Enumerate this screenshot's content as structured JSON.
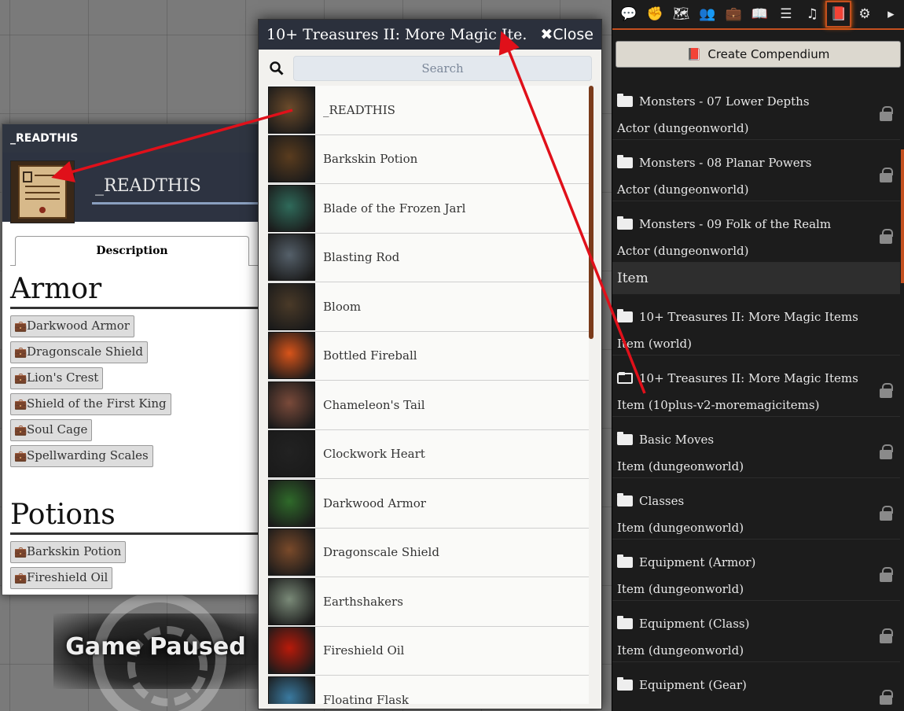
{
  "overlay": {
    "paused_text": "Game Paused"
  },
  "item_sheet": {
    "header_title": "_READTHIS",
    "name_value": "_READTHIS",
    "tab_label": "Description",
    "sections": [
      {
        "heading": "Armor",
        "items": [
          "Darkwood Armor",
          "Dragonscale Shield",
          "Lion's Crest",
          "Shield of the First King",
          "Soul Cage",
          "Spellwarding Scales"
        ]
      },
      {
        "heading": "Potions",
        "items": [
          "Barkskin Potion",
          "Fireshield Oil"
        ]
      }
    ]
  },
  "compendium": {
    "title": "10+ Treasures II: More Magic Ite...",
    "close_label": "Close",
    "search_placeholder": "Search",
    "entries": [
      {
        "name": "_READTHIS",
        "color": "#6b4a2a"
      },
      {
        "name": "Barkskin Potion",
        "color": "#5a3c1e"
      },
      {
        "name": "Blade of the Frozen Jarl",
        "color": "#2f6a5a"
      },
      {
        "name": "Blasting Rod",
        "color": "#55606a"
      },
      {
        "name": "Bloom",
        "color": "#4a3a28"
      },
      {
        "name": "Bottled Fireball",
        "color": "#d8541a"
      },
      {
        "name": "Chameleon's Tail",
        "color": "#7a4a3a"
      },
      {
        "name": "Clockwork Heart",
        "color": "#222222"
      },
      {
        "name": "Darkwood Armor",
        "color": "#2f6a2a"
      },
      {
        "name": "Dragonscale Shield",
        "color": "#7a4a2a"
      },
      {
        "name": "Earthshakers",
        "color": "#7a8a78"
      },
      {
        "name": "Fireshield Oil",
        "color": "#b81a0a"
      },
      {
        "name": "Floating Flask",
        "color": "#3a7aa0"
      }
    ]
  },
  "sidebar": {
    "tabs": [
      {
        "name": "chat-tab",
        "glyph": "💬"
      },
      {
        "name": "combat-tab",
        "glyph": "✊"
      },
      {
        "name": "scenes-tab",
        "glyph": "🗺"
      },
      {
        "name": "actors-tab",
        "glyph": "👥"
      },
      {
        "name": "items-tab",
        "glyph": "💼"
      },
      {
        "name": "journal-tab",
        "glyph": "📖"
      },
      {
        "name": "tables-tab",
        "glyph": "☰"
      },
      {
        "name": "playlists-tab",
        "glyph": "♫"
      },
      {
        "name": "compendium-tab",
        "glyph": "📕"
      },
      {
        "name": "settings-tab",
        "glyph": "⚙"
      },
      {
        "name": "collapse-tab",
        "glyph": "▸"
      }
    ],
    "create_button": "Create Compendium",
    "packs_top": [
      {
        "title": "Monsters - 07 Lower Depths",
        "sub": "Actor (dungeonworld)"
      },
      {
        "title": "Monsters - 08 Planar Powers",
        "sub": "Actor (dungeonworld)"
      },
      {
        "title": "Monsters - 09 Folk of the Realm",
        "sub": "Actor (dungeonworld)"
      }
    ],
    "group_label": "Item",
    "packs_item": [
      {
        "title": "10+ Treasures II: More Magic Items",
        "sub": "Item (world)",
        "locked": false,
        "open": false
      },
      {
        "title": "10+ Treasures II: More Magic Items",
        "sub": "Item (10plus-v2-moremagicitems)",
        "locked": true,
        "open": true
      },
      {
        "title": "Basic Moves",
        "sub": "Item (dungeonworld)",
        "locked": true,
        "open": false
      },
      {
        "title": "Classes",
        "sub": "Item (dungeonworld)",
        "locked": true,
        "open": false
      },
      {
        "title": "Equipment (Armor)",
        "sub": "Item (dungeonworld)",
        "locked": true,
        "open": false
      },
      {
        "title": "Equipment (Class)",
        "sub": "Item (dungeonworld)",
        "locked": true,
        "open": false
      },
      {
        "title": "Equipment (Gear)",
        "sub": "",
        "locked": true,
        "open": false
      }
    ]
  },
  "colors": {
    "accent": "#c4501f",
    "arrow": "#e0101a",
    "header": "#2b303c"
  }
}
